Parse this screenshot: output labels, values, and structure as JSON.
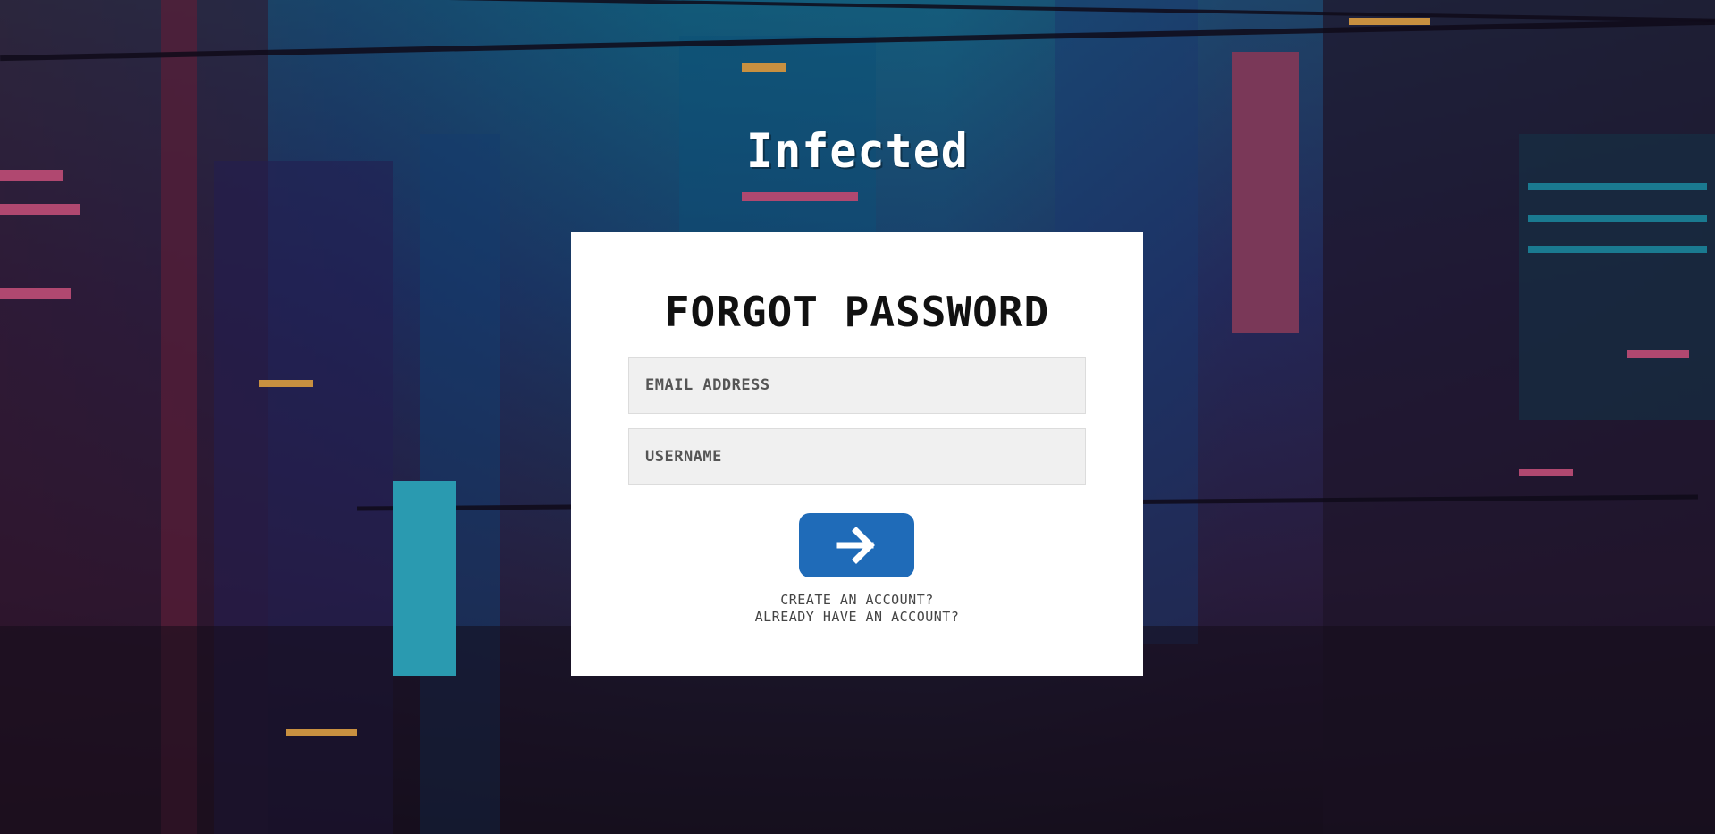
{
  "brand": {
    "logo_text": "Infected"
  },
  "form": {
    "title": "FORGOT PASSWORD",
    "email_placeholder": "EMAIL ADDRESS",
    "username_placeholder": "USERNAME",
    "submit_icon": "arrow-right-icon"
  },
  "links": {
    "create_account": "CREATE AN ACCOUNT?",
    "have_account": "ALREADY HAVE AN ACCOUNT?"
  },
  "colors": {
    "card_background": "#ffffff",
    "input_background": "#f0f0f0",
    "submit_button": "#1f6bb8",
    "title_text": "#111111"
  }
}
